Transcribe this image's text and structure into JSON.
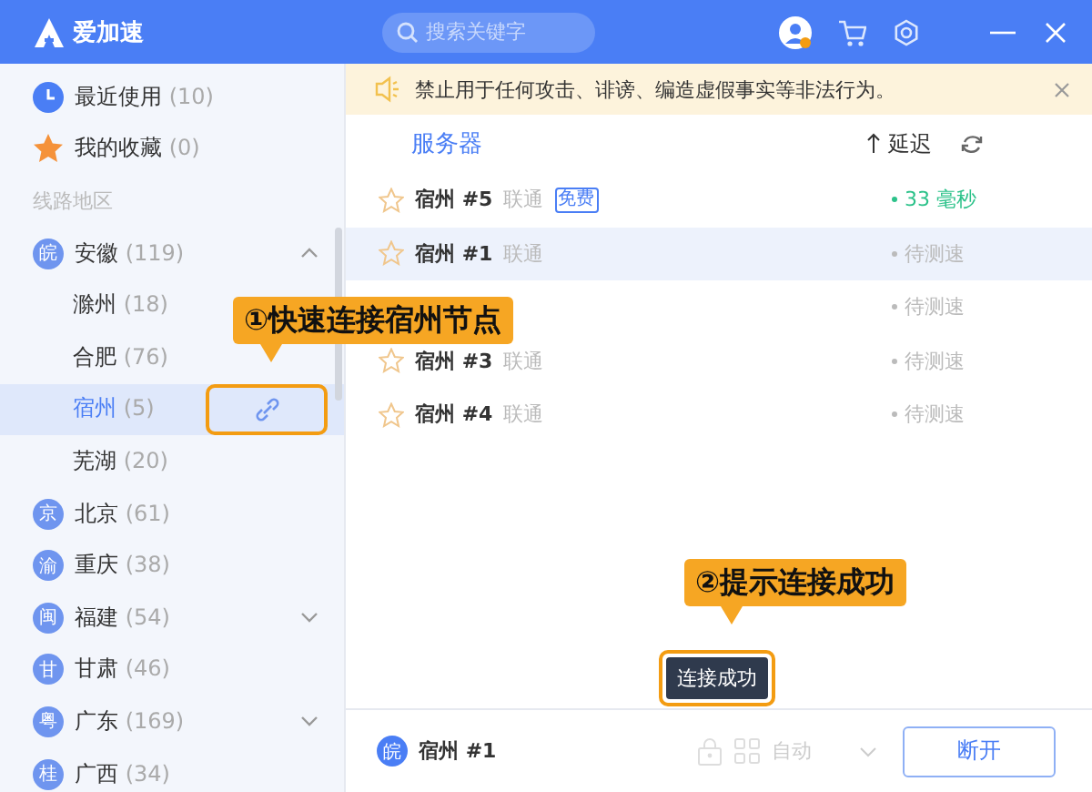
{
  "app": {
    "name": "爱加速"
  },
  "search": {
    "placeholder": "搜索关键字"
  },
  "sidebar": {
    "items": [
      {
        "kind": "recent",
        "label": "最近使用",
        "count": "(10)"
      },
      {
        "kind": "favorites",
        "label": "我的收藏",
        "count": "(0)"
      },
      {
        "kind": "heading",
        "label": "线路地区"
      },
      {
        "kind": "region",
        "badge": "皖",
        "label": "安徽",
        "count": "(119)",
        "expanded": true
      },
      {
        "kind": "city",
        "label": "滁州",
        "count": "(18)",
        "selected": false
      },
      {
        "kind": "city",
        "label": "合肥",
        "count": "(76)",
        "selected": false
      },
      {
        "kind": "city",
        "label": "宿州",
        "count": "(5)",
        "selected": true
      },
      {
        "kind": "city",
        "label": "芜湖",
        "count": "(20)",
        "selected": false
      },
      {
        "kind": "region",
        "badge": "京",
        "label": "北京",
        "count": "(61)"
      },
      {
        "kind": "region",
        "badge": "渝",
        "label": "重庆",
        "count": "(38)"
      },
      {
        "kind": "region",
        "badge": "闽",
        "label": "福建",
        "count": "(54)",
        "expanded": false
      },
      {
        "kind": "region",
        "badge": "甘",
        "label": "甘肃",
        "count": "(46)"
      },
      {
        "kind": "region",
        "badge": "粤",
        "label": "广东",
        "count": "(169)",
        "expanded": false
      },
      {
        "kind": "region",
        "badge": "桂",
        "label": "广西",
        "count": "(34)"
      }
    ]
  },
  "notice": {
    "text": "禁止用于任何攻击、诽谤、编造虚假事实等非法行为。"
  },
  "table": {
    "columns": [
      "服务器",
      "延迟"
    ],
    "rows": [
      {
        "name": "宿州 #5",
        "isp": "联通",
        "tag": "免费",
        "latency": "33 毫秒",
        "measured": true,
        "selected": false
      },
      {
        "name": "宿州 #1",
        "isp": "联通",
        "latency": "待测速",
        "measured": false,
        "selected": true
      },
      {
        "latency": "待测速",
        "measured": false,
        "selected": false
      },
      {
        "name": "宿州 #3",
        "isp": "联通",
        "latency": "待测速",
        "measured": false,
        "selected": false
      },
      {
        "name": "宿州 #4",
        "isp": "联通",
        "latency": "待测速",
        "measured": false,
        "selected": false
      }
    ]
  },
  "toast": {
    "text": "连接成功"
  },
  "footer": {
    "badge": "皖",
    "server": "宿州 #1",
    "mode": "自动",
    "button": "断开"
  },
  "annotations": [
    "①快速连接宿州节点",
    "②提示连接成功"
  ]
}
